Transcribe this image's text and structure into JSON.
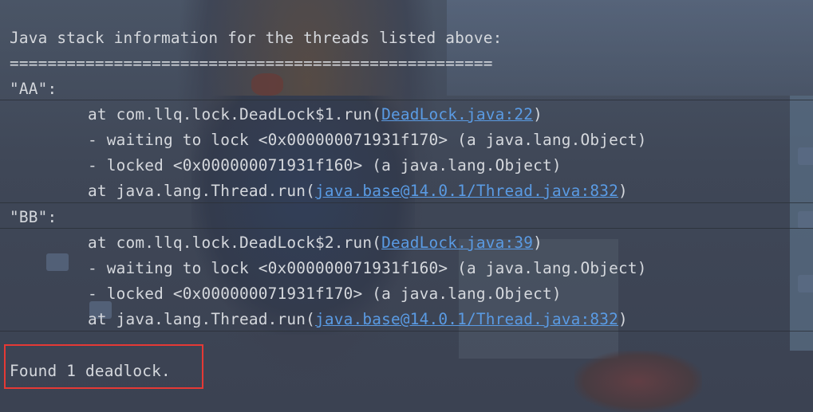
{
  "console": {
    "header": "Java stack information for the threads listed above:",
    "separator": "===================================================",
    "threads": [
      {
        "name": "\"AA\":",
        "frames": [
          {
            "prefix": "at com.llq.lock.DeadLock$1.run(",
            "link": "DeadLock.java:22",
            "suffix": ")"
          },
          {
            "text": "- waiting to lock <0x000000071931f170> (a java.lang.Object)"
          },
          {
            "text": "- locked <0x000000071931f160> (a java.lang.Object)"
          },
          {
            "prefix": "at java.lang.Thread.run(",
            "link": "java.base@14.0.1/Thread.java:832",
            "suffix": ")"
          }
        ]
      },
      {
        "name": "\"BB\":",
        "frames": [
          {
            "prefix": "at com.llq.lock.DeadLock$2.run(",
            "link": "DeadLock.java:39",
            "suffix": ")"
          },
          {
            "text": "- waiting to lock <0x000000071931f160> (a java.lang.Object)"
          },
          {
            "text": "- locked <0x000000071931f170> (a java.lang.Object)"
          },
          {
            "prefix": "at java.lang.Thread.run(",
            "link": "java.base@14.0.1/Thread.java:832",
            "suffix": ")"
          }
        ]
      }
    ],
    "result": "Found 1 deadlock."
  },
  "colors": {
    "text": "#d5d8dd",
    "link": "#5a9be4",
    "highlight_border": "#e53935"
  }
}
